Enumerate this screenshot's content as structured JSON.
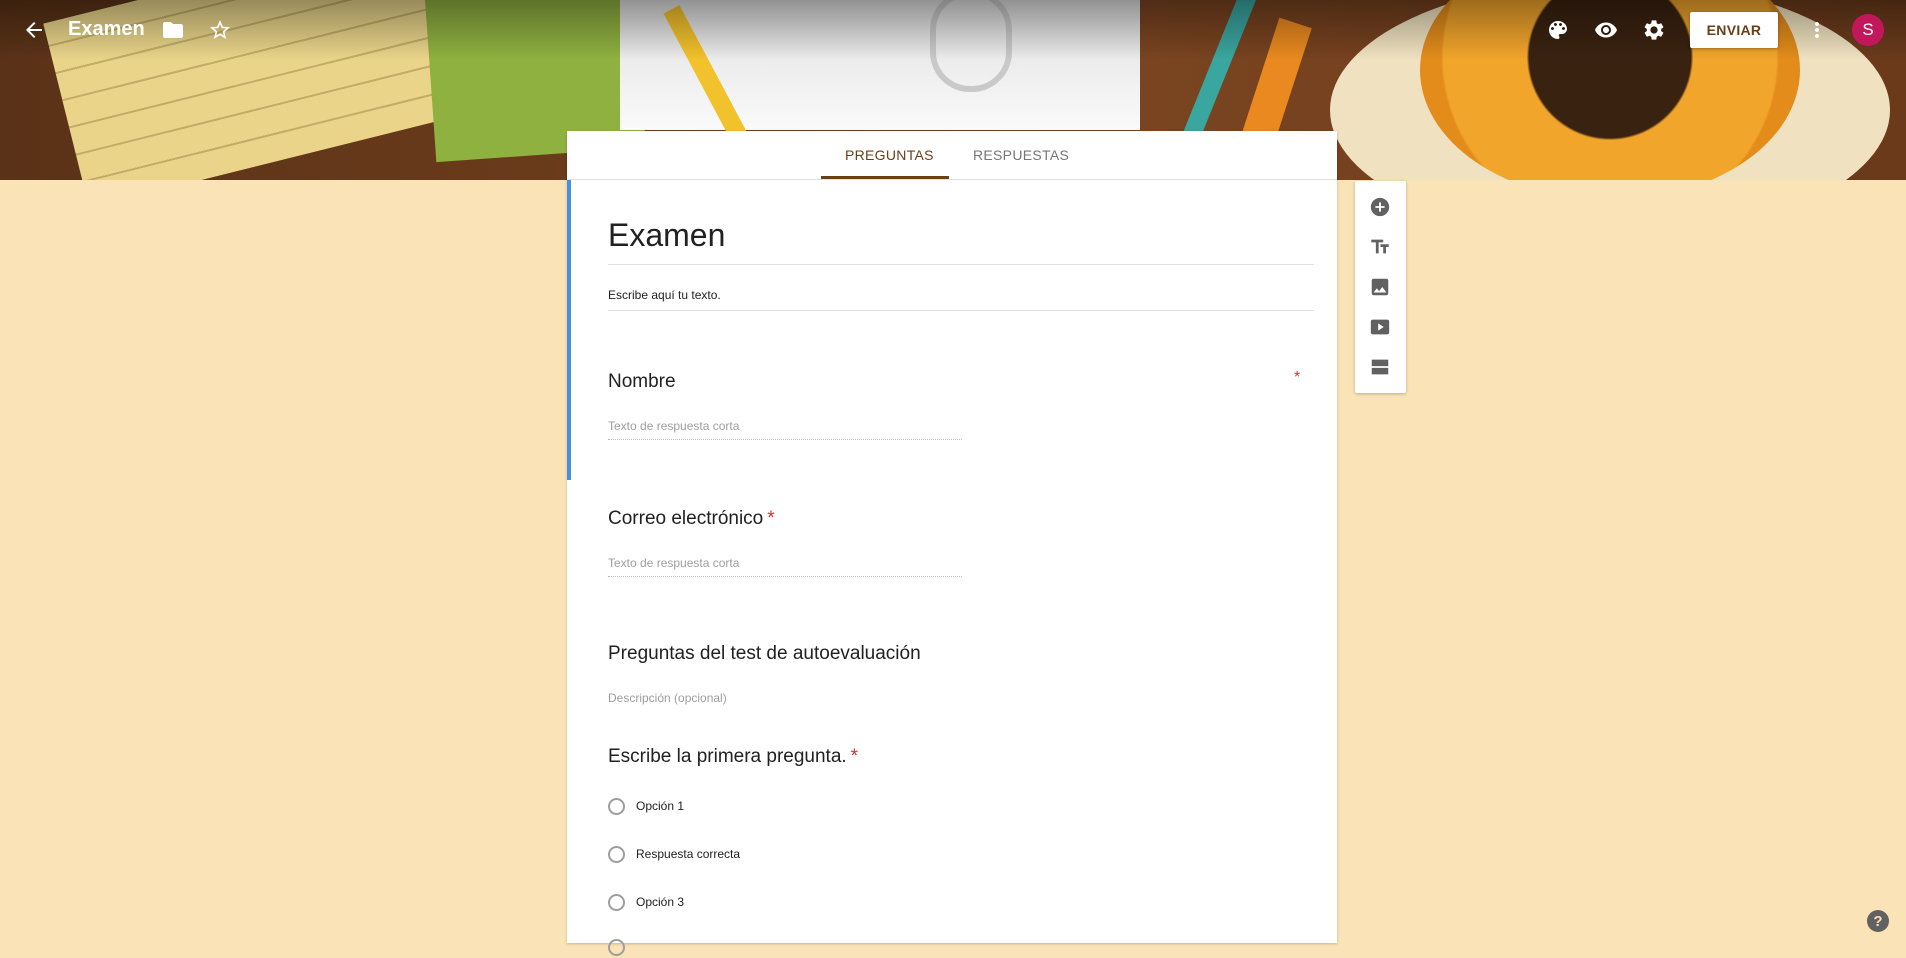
{
  "header": {
    "title": "Examen",
    "send_label": "ENVIAR",
    "avatar_initial": "S"
  },
  "tabs": [
    {
      "label": "PREGUNTAS",
      "active": true
    },
    {
      "label": "RESPUESTAS",
      "active": false
    }
  ],
  "form": {
    "title": "Examen",
    "description": "Escribe aquí tu texto.",
    "questions": [
      {
        "title": "Nombre",
        "required": true,
        "answer_placeholder": "Texto de respuesta corta"
      },
      {
        "title": "Correo electrónico",
        "required": true,
        "answer_placeholder": "Texto de respuesta corta"
      }
    ],
    "section": {
      "title": "Preguntas del test de autoevaluación",
      "description_placeholder": "Descripción (opcional)"
    },
    "multiple_choice": {
      "title": "Escribe la primera pregunta.",
      "required": true,
      "options": [
        "Opción 1",
        "Respuesta correcta",
        "Opción 3"
      ]
    }
  },
  "required_mark": "*",
  "help_label": "?",
  "colors": {
    "accent": "#6b4014",
    "background": "#fbe3b8",
    "focus_bar": "#4a90e2",
    "required": "#d93025",
    "avatar": "#c2185b"
  },
  "icons": {
    "topbar": [
      "arrow-back-icon",
      "folder-icon",
      "star-outline-icon",
      "palette-icon",
      "eye-icon",
      "gear-icon",
      "more-vert-icon"
    ],
    "toolbar": [
      "add-circle-icon",
      "title-text-icon",
      "image-icon",
      "video-icon",
      "section-icon"
    ],
    "help": "help-icon"
  }
}
